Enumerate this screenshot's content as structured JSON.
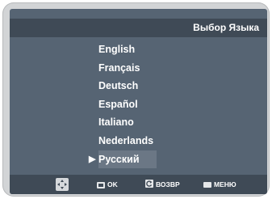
{
  "header": {
    "title": "Выбор Языка"
  },
  "languages": {
    "items": [
      "English",
      "Français",
      "Deutsch",
      "Español",
      "Italiano",
      "Nederlands",
      "Русский"
    ],
    "selected_index": 6
  },
  "footer": {
    "ok_label": "OK",
    "return_label": "ВОЗВР",
    "menu_label": "МЕНЮ"
  },
  "colors": {
    "screen_bg": "#566473",
    "bar_bg": "#3f4a56",
    "selected_bg": "#6b7785",
    "frame": "#d2d4d6",
    "text": "#ffffff"
  },
  "icons": {
    "nav": "navigation-pad-icon",
    "ok": "ok-button-icon",
    "return": "return-arrow-icon",
    "menu": "menu-button-icon"
  }
}
